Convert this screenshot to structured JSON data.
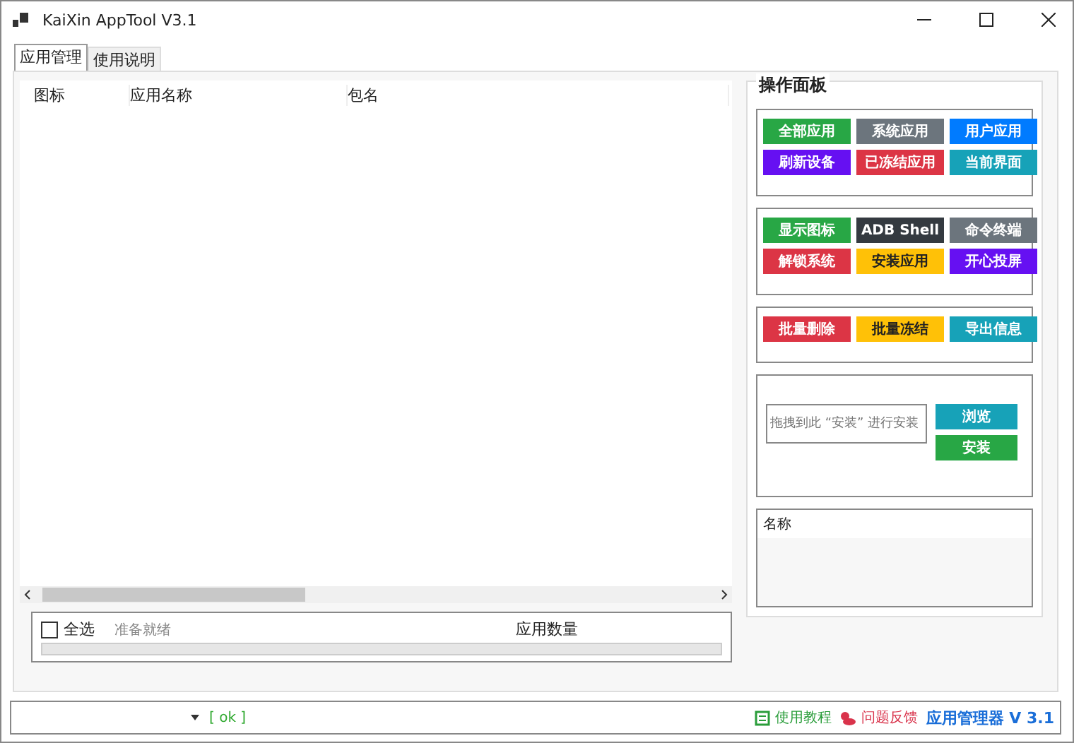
{
  "window": {
    "title": "KaiXin AppTool V3.1"
  },
  "tabs": [
    {
      "label": "应用管理",
      "selected": true
    },
    {
      "label": "使用说明",
      "selected": false
    }
  ],
  "table": {
    "columns": [
      "图标",
      "应用名称",
      "包名"
    ]
  },
  "footer": {
    "select_all": {
      "label": "全选",
      "checked": false
    },
    "status": "准备就绪",
    "count_label": "应用数量",
    "progress": {
      "level": 0
    }
  },
  "control_panel": {
    "title": "操作面板",
    "groups": [
      [
        {
          "label": "全部应用",
          "color": "#28a745"
        },
        {
          "label": "系统应用",
          "color": "#6c757d"
        },
        {
          "label": "用户应用",
          "color": "#007bff"
        },
        {
          "label": "刷新设备",
          "color": "#6610f2"
        },
        {
          "label": "已冻结应用",
          "color": "#dc3545"
        },
        {
          "label": "当前界面",
          "color": "#17a2b8"
        }
      ],
      [
        {
          "label": "显示图标",
          "color": "#28a745"
        },
        {
          "label": "ADB Shell",
          "color": "#343a40"
        },
        {
          "label": "命令终端",
          "color": "#6c757d"
        },
        {
          "label": "解锁系统",
          "color": "#dc3545"
        },
        {
          "label": "安装应用",
          "color": "#ffc107"
        },
        {
          "label": "开心投屏",
          "color": "#6610f2"
        }
      ],
      [
        {
          "label": "批量删除",
          "color": "#dc3545"
        },
        {
          "label": "批量冻结",
          "color": "#ffc107"
        },
        {
          "label": "导出信息",
          "color": "#17a2b8"
        }
      ]
    ],
    "apk": {
      "placeholder": "拖拽到此 “安装” 进行安装",
      "browse": {
        "label": "浏览",
        "color": "#17a2b8"
      },
      "install": {
        "label": "安装",
        "color": "#28a745"
      }
    },
    "name_box": {
      "header": "名称"
    }
  },
  "status_bar": {
    "result": "[ ok ]",
    "links": [
      {
        "kind": "tutorial",
        "label": "使用教程"
      },
      {
        "kind": "feedback",
        "label": "问题反馈"
      }
    ],
    "version": "应用管理器 V 3.1"
  }
}
